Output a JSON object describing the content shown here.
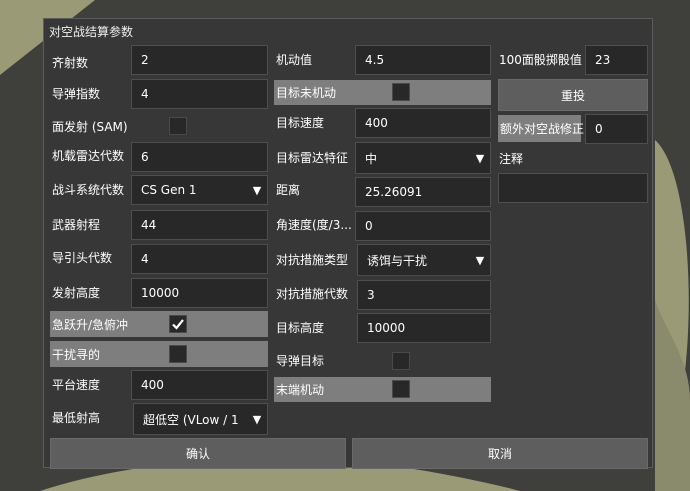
{
  "dialog": {
    "title": "对空战结算参数"
  },
  "col1": {
    "salvo_label": "齐射数",
    "salvo_value": "2",
    "missile_index_label": "导弹指数",
    "missile_index_value": "4",
    "surface_launch_label": "面发射 (SAM)",
    "airborne_radar_label": "机载雷达代数",
    "airborne_radar_value": "6",
    "combat_system_label": "战斗系统代数",
    "combat_system_value": "CS Gen 1",
    "weapon_range_label": "武器射程",
    "weapon_range_value": "44",
    "seeker_gen_label": "导引头代数",
    "seeker_gen_value": "4",
    "launch_alt_label": "发射高度",
    "launch_alt_value": "10000",
    "zoom_dive_label": "急跃升/急俯冲",
    "jammed_seeker_label": "干扰寻的",
    "platform_speed_label": "平台速度",
    "platform_speed_value": "400",
    "min_alt_label": "最低射高",
    "min_alt_value": "超低空 (VLow / 1"
  },
  "col2": {
    "maneuver_label": "机动值",
    "maneuver_value": "4.5",
    "target_no_maneuver_label": "目标未机动",
    "target_speed_label": "目标速度",
    "target_speed_value": "400",
    "target_radar_sig_label": "目标雷达特征",
    "target_radar_sig_value": "中",
    "distance_label": "距离",
    "distance_value": "25.26091",
    "angular_speed_label": "角速度(度/3...",
    "angular_speed_value": "0",
    "cm_type_label": "对抗措施类型",
    "cm_type_value": "诱饵与干扰",
    "cm_gen_label": "对抗措施代数",
    "cm_gen_value": "3",
    "target_alt_label": "目标高度",
    "target_alt_value": "10000",
    "missile_target_label": "导弹目标",
    "terminal_maneuver_label": "末端机动"
  },
  "col3": {
    "d100_label": "100面骰掷骰值",
    "d100_value": "23",
    "reroll_label": "重投",
    "extra_mod_label": "额外对空战修正",
    "extra_mod_value": "0",
    "notes_label": "注释",
    "notes_value": ""
  },
  "footer": {
    "confirm_label": "确认",
    "cancel_label": "取消"
  },
  "checks": {
    "zoom_dive": true,
    "jammed_seeker": false,
    "surface_launch": false,
    "target_no_maneuver": false,
    "missile_target": false,
    "terminal_maneuver": false
  },
  "colors": {
    "panel": "#373737",
    "field": "#282828",
    "highlight_row": "#7e7e7e",
    "button": "#5e5e5e",
    "background_shape": "#9a9a77"
  }
}
